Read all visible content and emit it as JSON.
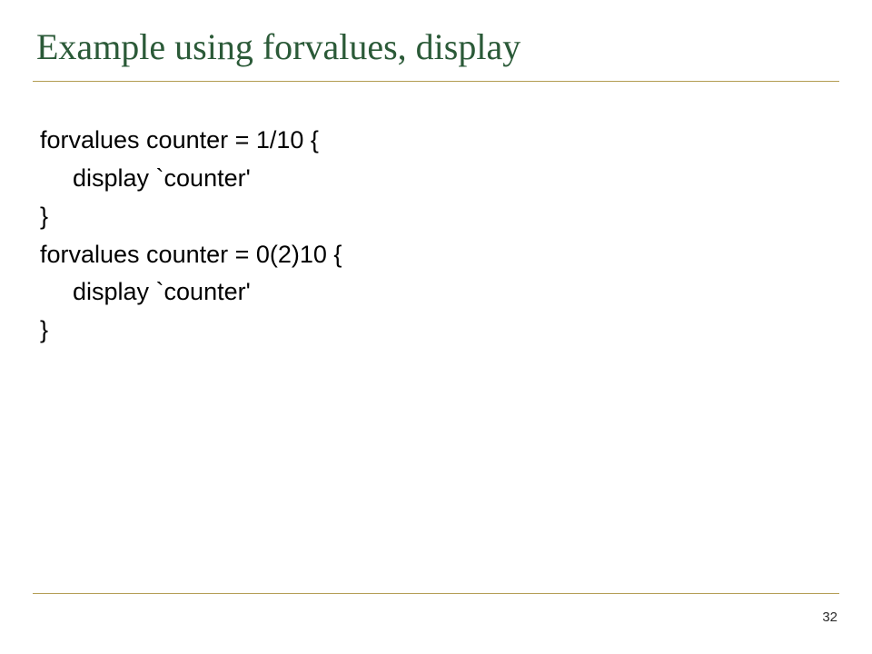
{
  "slide": {
    "title": "Example using forvalues, display",
    "code": {
      "l1": "forvalues counter = 1/10 {",
      "l2": "display `counter'",
      "l3": "}",
      "l4": "forvalues counter = 0(2)10 {",
      "l5": "display `counter'",
      "l6": "}"
    },
    "page_number": "32"
  }
}
